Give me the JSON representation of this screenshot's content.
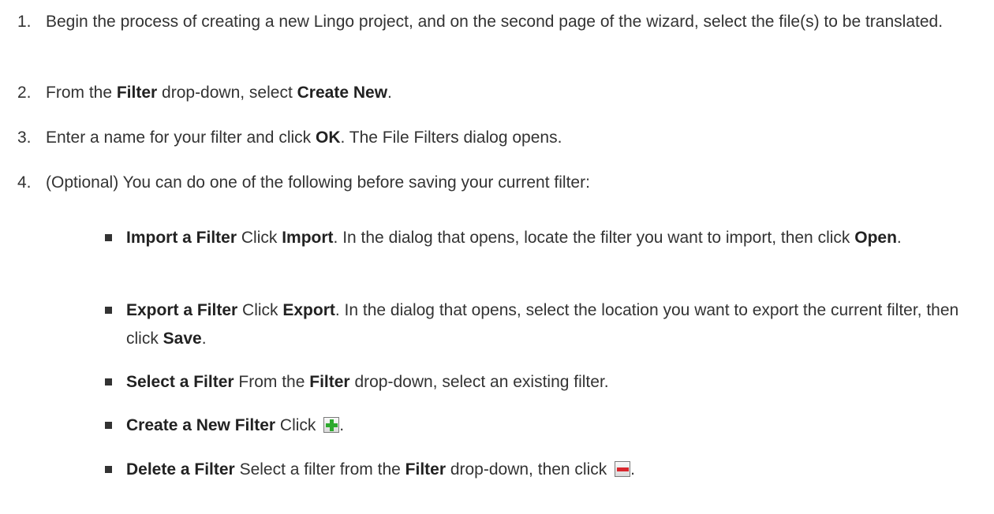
{
  "steps": [
    {
      "n": "1.",
      "a": "Begin the process of creating a new Lingo project, and on the second page of the wizard, select the file(s) to be translated."
    },
    {
      "n": "2.",
      "a": "From the ",
      "b1": "Filter",
      "c": " drop-down, select ",
      "b2": "Create New",
      "d": "."
    },
    {
      "n": "3.",
      "a": "Enter a name for your filter and click ",
      "b1": "OK",
      "c": ". The File Filters dialog opens."
    },
    {
      "n": "4.",
      "a": "(Optional) You can do one of the following before saving your current filter:"
    }
  ],
  "bullets": [
    {
      "title": "Import a Filter",
      "a": " Click ",
      "b1": "Import",
      "c": ". In the dialog that opens, locate the filter you want to import, then click ",
      "b2": "Open",
      "d": "."
    },
    {
      "title": "Export a Filter",
      "a": " Click ",
      "b1": "Export",
      "c": ". In the dialog that opens, select the location you want to export the current filter, then click ",
      "b2": "Save",
      "d": "."
    },
    {
      "title": "Select a Filter",
      "a": " From the ",
      "b1": "Filter",
      "c": " drop-down, select an existing filter."
    },
    {
      "title": "Create a New Filter",
      "a": " Click ",
      "d": "."
    },
    {
      "title": "Delete a Filter",
      "a": " Select a filter from the ",
      "b1": "Filter",
      "c": " drop-down, then click ",
      "d": "."
    }
  ],
  "icons": {
    "add": "add-filter-icon",
    "delete": "delete-filter-icon",
    "add_color": "#2eaa2e",
    "delete_color": "#d9272e"
  }
}
